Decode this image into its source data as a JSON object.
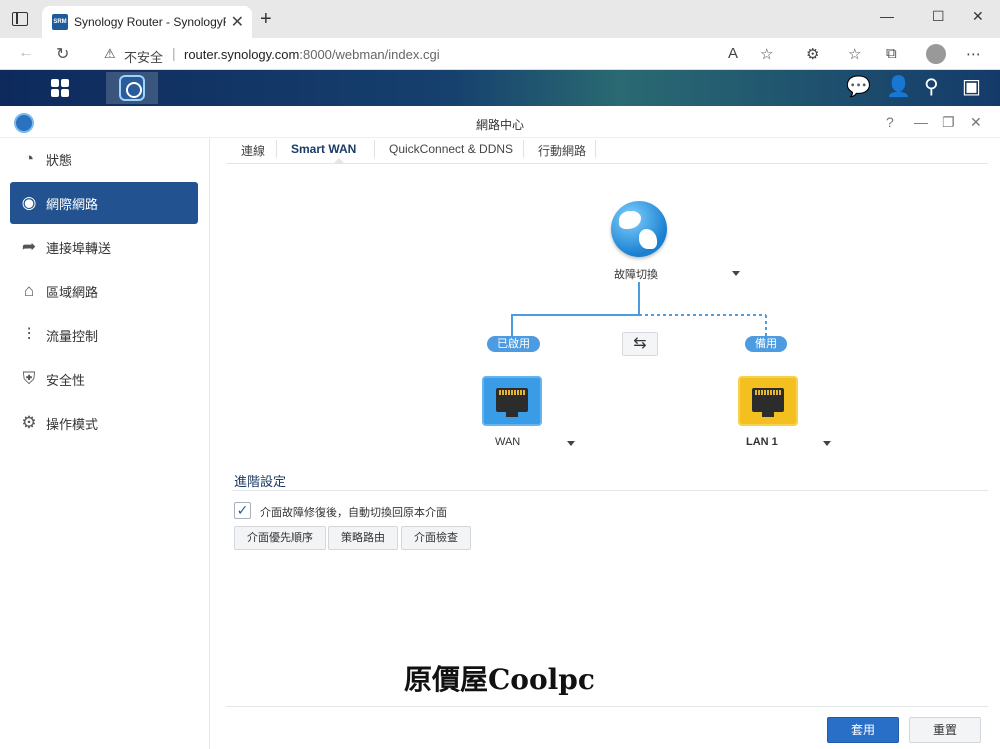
{
  "browser": {
    "tab_title": "Synology Router - SynologyRouter",
    "favicon_text": "SRM",
    "insecure_label": "不安全",
    "url_host": "router.synology.com",
    "url_path": ":8000/webman/index.cgi",
    "zoom_icon_text": "A"
  },
  "window": {
    "title": "網路中心"
  },
  "sidebar": {
    "items": [
      {
        "label": "狀態",
        "icon": "gauge-icon"
      },
      {
        "label": "網際網路",
        "icon": "globe-icon"
      },
      {
        "label": "連接埠轉送",
        "icon": "forward-arrow-icon"
      },
      {
        "label": "區域網路",
        "icon": "home-network-icon"
      },
      {
        "label": "流量控制",
        "icon": "sliders-icon"
      },
      {
        "label": "安全性",
        "icon": "shield-icon"
      },
      {
        "label": "操作模式",
        "icon": "router-gear-icon"
      }
    ],
    "active_index": 1
  },
  "tabs": [
    "連線",
    "Smart WAN",
    "QuickConnect & DDNS",
    "行動網路"
  ],
  "active_tab": "Smart WAN",
  "diagram": {
    "mode_label": "故障切換",
    "primary_badge": "已啟用",
    "backup_badge": "備用",
    "wan_label": "WAN",
    "lan_label": "LAN 1",
    "colors": {
      "line": "#4d9be0",
      "wan_port": "#3a9be6",
      "lan_port": "#f4c020"
    }
  },
  "advanced": {
    "title": "進階設定",
    "checkbox_label": "介面故障修復後，自動切換回原本介面",
    "checkbox_checked": true,
    "buttons": [
      "介面優先順序",
      "策略路由",
      "介面檢查"
    ]
  },
  "watermark": "原價屋Coolpc",
  "footer": {
    "apply_label": "套用",
    "reset_label": "重置"
  }
}
